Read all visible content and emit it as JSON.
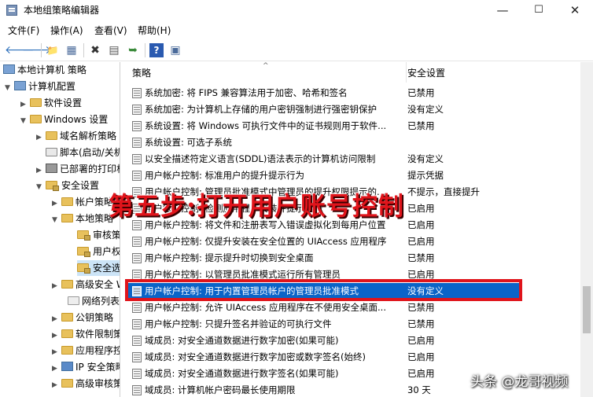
{
  "window": {
    "title": "本地组策略编辑器",
    "min": "—",
    "max": "☐",
    "close": "✕"
  },
  "menu": [
    "文件(F)",
    "操作(A)",
    "查看(V)",
    "帮助(H)"
  ],
  "toolbar": {
    "back": "🡐",
    "forward": "🡒",
    "up": "📁",
    "show": "▦",
    "delete": "✖",
    "props": "▤",
    "export": "➥",
    "help": "?",
    "view": "▣"
  },
  "tree": [
    {
      "label": "本地计算机 策略"
    },
    {
      "label": "计算机配置"
    },
    {
      "label": "软件设置"
    },
    {
      "label": "Windows 设置"
    },
    {
      "label": "域名解析策略"
    },
    {
      "label": "脚本(启动/关机)"
    },
    {
      "label": "已部署的打印机"
    },
    {
      "label": "安全设置"
    },
    {
      "label": "帐户策略"
    },
    {
      "label": "本地策略"
    },
    {
      "label": "审核策略"
    },
    {
      "label": "用户权限分配"
    },
    {
      "label": "安全选项"
    },
    {
      "label": "高级安全 Windows"
    },
    {
      "label": "网络列表管理器策略"
    },
    {
      "label": "公钥策略"
    },
    {
      "label": "软件限制策略"
    },
    {
      "label": "应用程序控制策略"
    },
    {
      "label": "IP 安全策略"
    },
    {
      "label": "高级审核策略配置"
    }
  ],
  "columns": {
    "policy": "策略",
    "setting": "安全设置"
  },
  "rows": [
    {
      "name": "系统加密: 将 FIPS 兼容算法用于加密、哈希和签名",
      "value": "已禁用"
    },
    {
      "name": "系统加密: 为计算机上存储的用户密钥强制进行强密钥保护",
      "value": "没有定义"
    },
    {
      "name": "系统设置: 将 Windows 可执行文件中的证书规则用于软件...",
      "value": "已禁用"
    },
    {
      "name": "系统设置: 可选子系统",
      "value": ""
    },
    {
      "name": "以安全描述符定义语言(SDDL)语法表示的计算机访问限制",
      "value": "没有定义"
    },
    {
      "name": "用户帐户控制: 标准用户的提升提示行为",
      "value": "提示凭据"
    },
    {
      "name": "用户帐户控制: 管理员批准模式中管理员的提升权限提示的...",
      "value": "不提示，直接提升"
    },
    {
      "name": "用户帐户控制: 检测应用程序安装并提示提升",
      "value": "已启用"
    },
    {
      "name": "用户帐户控制: 将文件和注册表写入错误虚拟化到每用户位置",
      "value": "已启用"
    },
    {
      "name": "用户帐户控制: 仅提升安装在安全位置的 UIAccess 应用程序",
      "value": "已启用"
    },
    {
      "name": "用户帐户控制: 提示提升时切换到安全桌面",
      "value": "已禁用"
    },
    {
      "name": "用户帐户控制: 以管理员批准模式运行所有管理员",
      "value": "已启用"
    },
    {
      "name": "用户帐户控制: 用于内置管理员帐户的管理员批准模式",
      "value": "没有定义"
    },
    {
      "name": "用户帐户控制: 允许 UIAccess 应用程序在不使用安全桌面...",
      "value": "已禁用"
    },
    {
      "name": "用户帐户控制: 只提升签名并验证的可执行文件",
      "value": "已禁用"
    },
    {
      "name": "域成员: 对安全通道数据进行数字加密(如果可能)",
      "value": "已启用"
    },
    {
      "name": "域成员: 对安全通道数据进行数字加密或数字签名(始终)",
      "value": "已启用"
    },
    {
      "name": "域成员: 对安全通道数据进行数字签名(如果可能)",
      "value": "已启用"
    },
    {
      "name": "域成员: 计算机帐户密码最长使用期限",
      "value": "30 天"
    }
  ],
  "selected_row": 12,
  "overlay_text": "第五步:打开用户账号控制",
  "watermark": "头条 @龙哥视频"
}
